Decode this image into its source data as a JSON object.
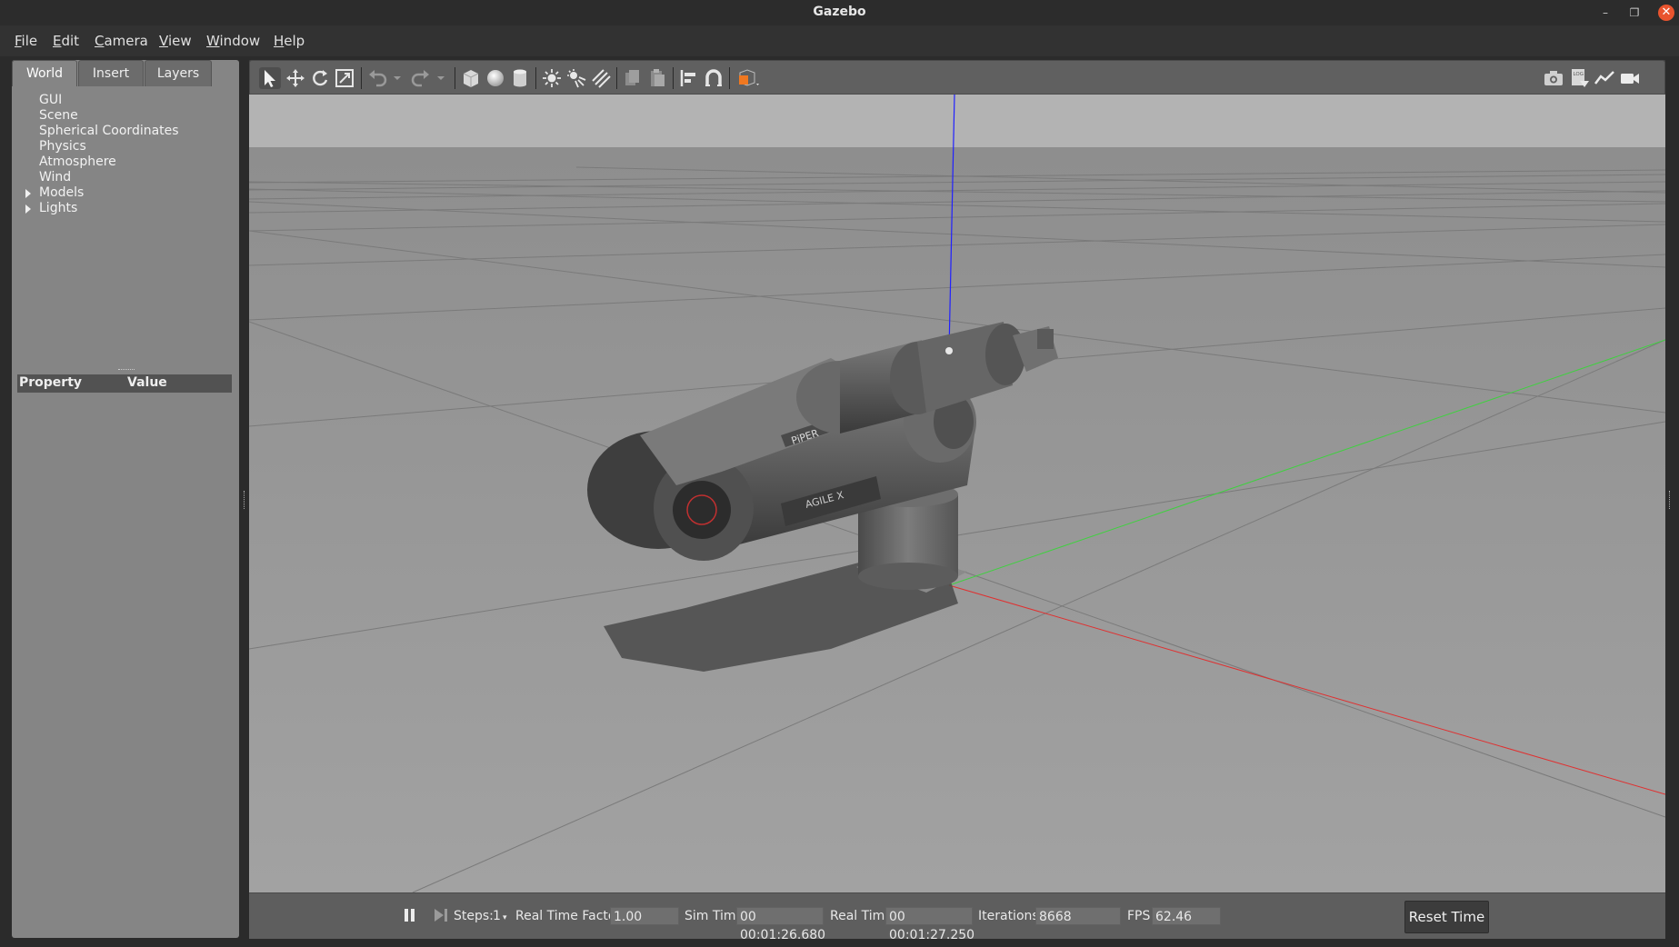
{
  "window": {
    "title": "Gazebo"
  },
  "menu": [
    "File",
    "Edit",
    "Camera",
    "View",
    "Window",
    "Help"
  ],
  "left_panel": {
    "tabs": [
      "World",
      "Insert",
      "Layers"
    ],
    "active_tab": "World",
    "tree": [
      {
        "label": "GUI",
        "expandable": false
      },
      {
        "label": "Scene",
        "expandable": false
      },
      {
        "label": "Spherical Coordinates",
        "expandable": false
      },
      {
        "label": "Physics",
        "expandable": false
      },
      {
        "label": "Atmosphere",
        "expandable": false
      },
      {
        "label": "Wind",
        "expandable": false
      },
      {
        "label": "Models",
        "expandable": true
      },
      {
        "label": "Lights",
        "expandable": true
      }
    ],
    "property_header": {
      "property": "Property",
      "value": "Value"
    }
  },
  "toolbar": {
    "tools": [
      "select-icon",
      "translate-icon",
      "rotate-icon",
      "scale-icon",
      "undo-icon",
      "redo-icon",
      "box-icon",
      "sphere-icon",
      "cylinder-icon",
      "point-light-icon",
      "spot-light-icon",
      "directional-light-icon",
      "copy-icon",
      "paste-icon",
      "align-icon",
      "snap-icon",
      "view-angle-icon",
      "screenshot-icon",
      "log-icon",
      "plot-icon",
      "video-record-icon"
    ],
    "active_tool": "select-icon"
  },
  "viewport": {
    "model_labels": {
      "arm": "PiPER",
      "brand": "AGILE X"
    }
  },
  "bottom_bar": {
    "steps_label": "Steps:",
    "steps_value": "1",
    "real_time_factor_label": "Real Time Factor:",
    "real_time_factor": "1.00",
    "sim_time_label": "Sim Time:",
    "sim_time": "00 00:01:26.680",
    "real_time_label": "Real Time:",
    "real_time": "00 00:01:27.250",
    "iterations_label": "Iterations:",
    "iterations": "8668",
    "fps_label": "FPS:",
    "fps": "62.46",
    "reset_label": "Reset Time"
  },
  "colors": {
    "ground": "#9a9a9a",
    "sky": "#b4b4b4",
    "z_axis": "#2020ff",
    "x_axis": "#e03030",
    "y_axis": "#40d040",
    "close_button": "#e9542e",
    "accent_orange": "#f07820"
  }
}
